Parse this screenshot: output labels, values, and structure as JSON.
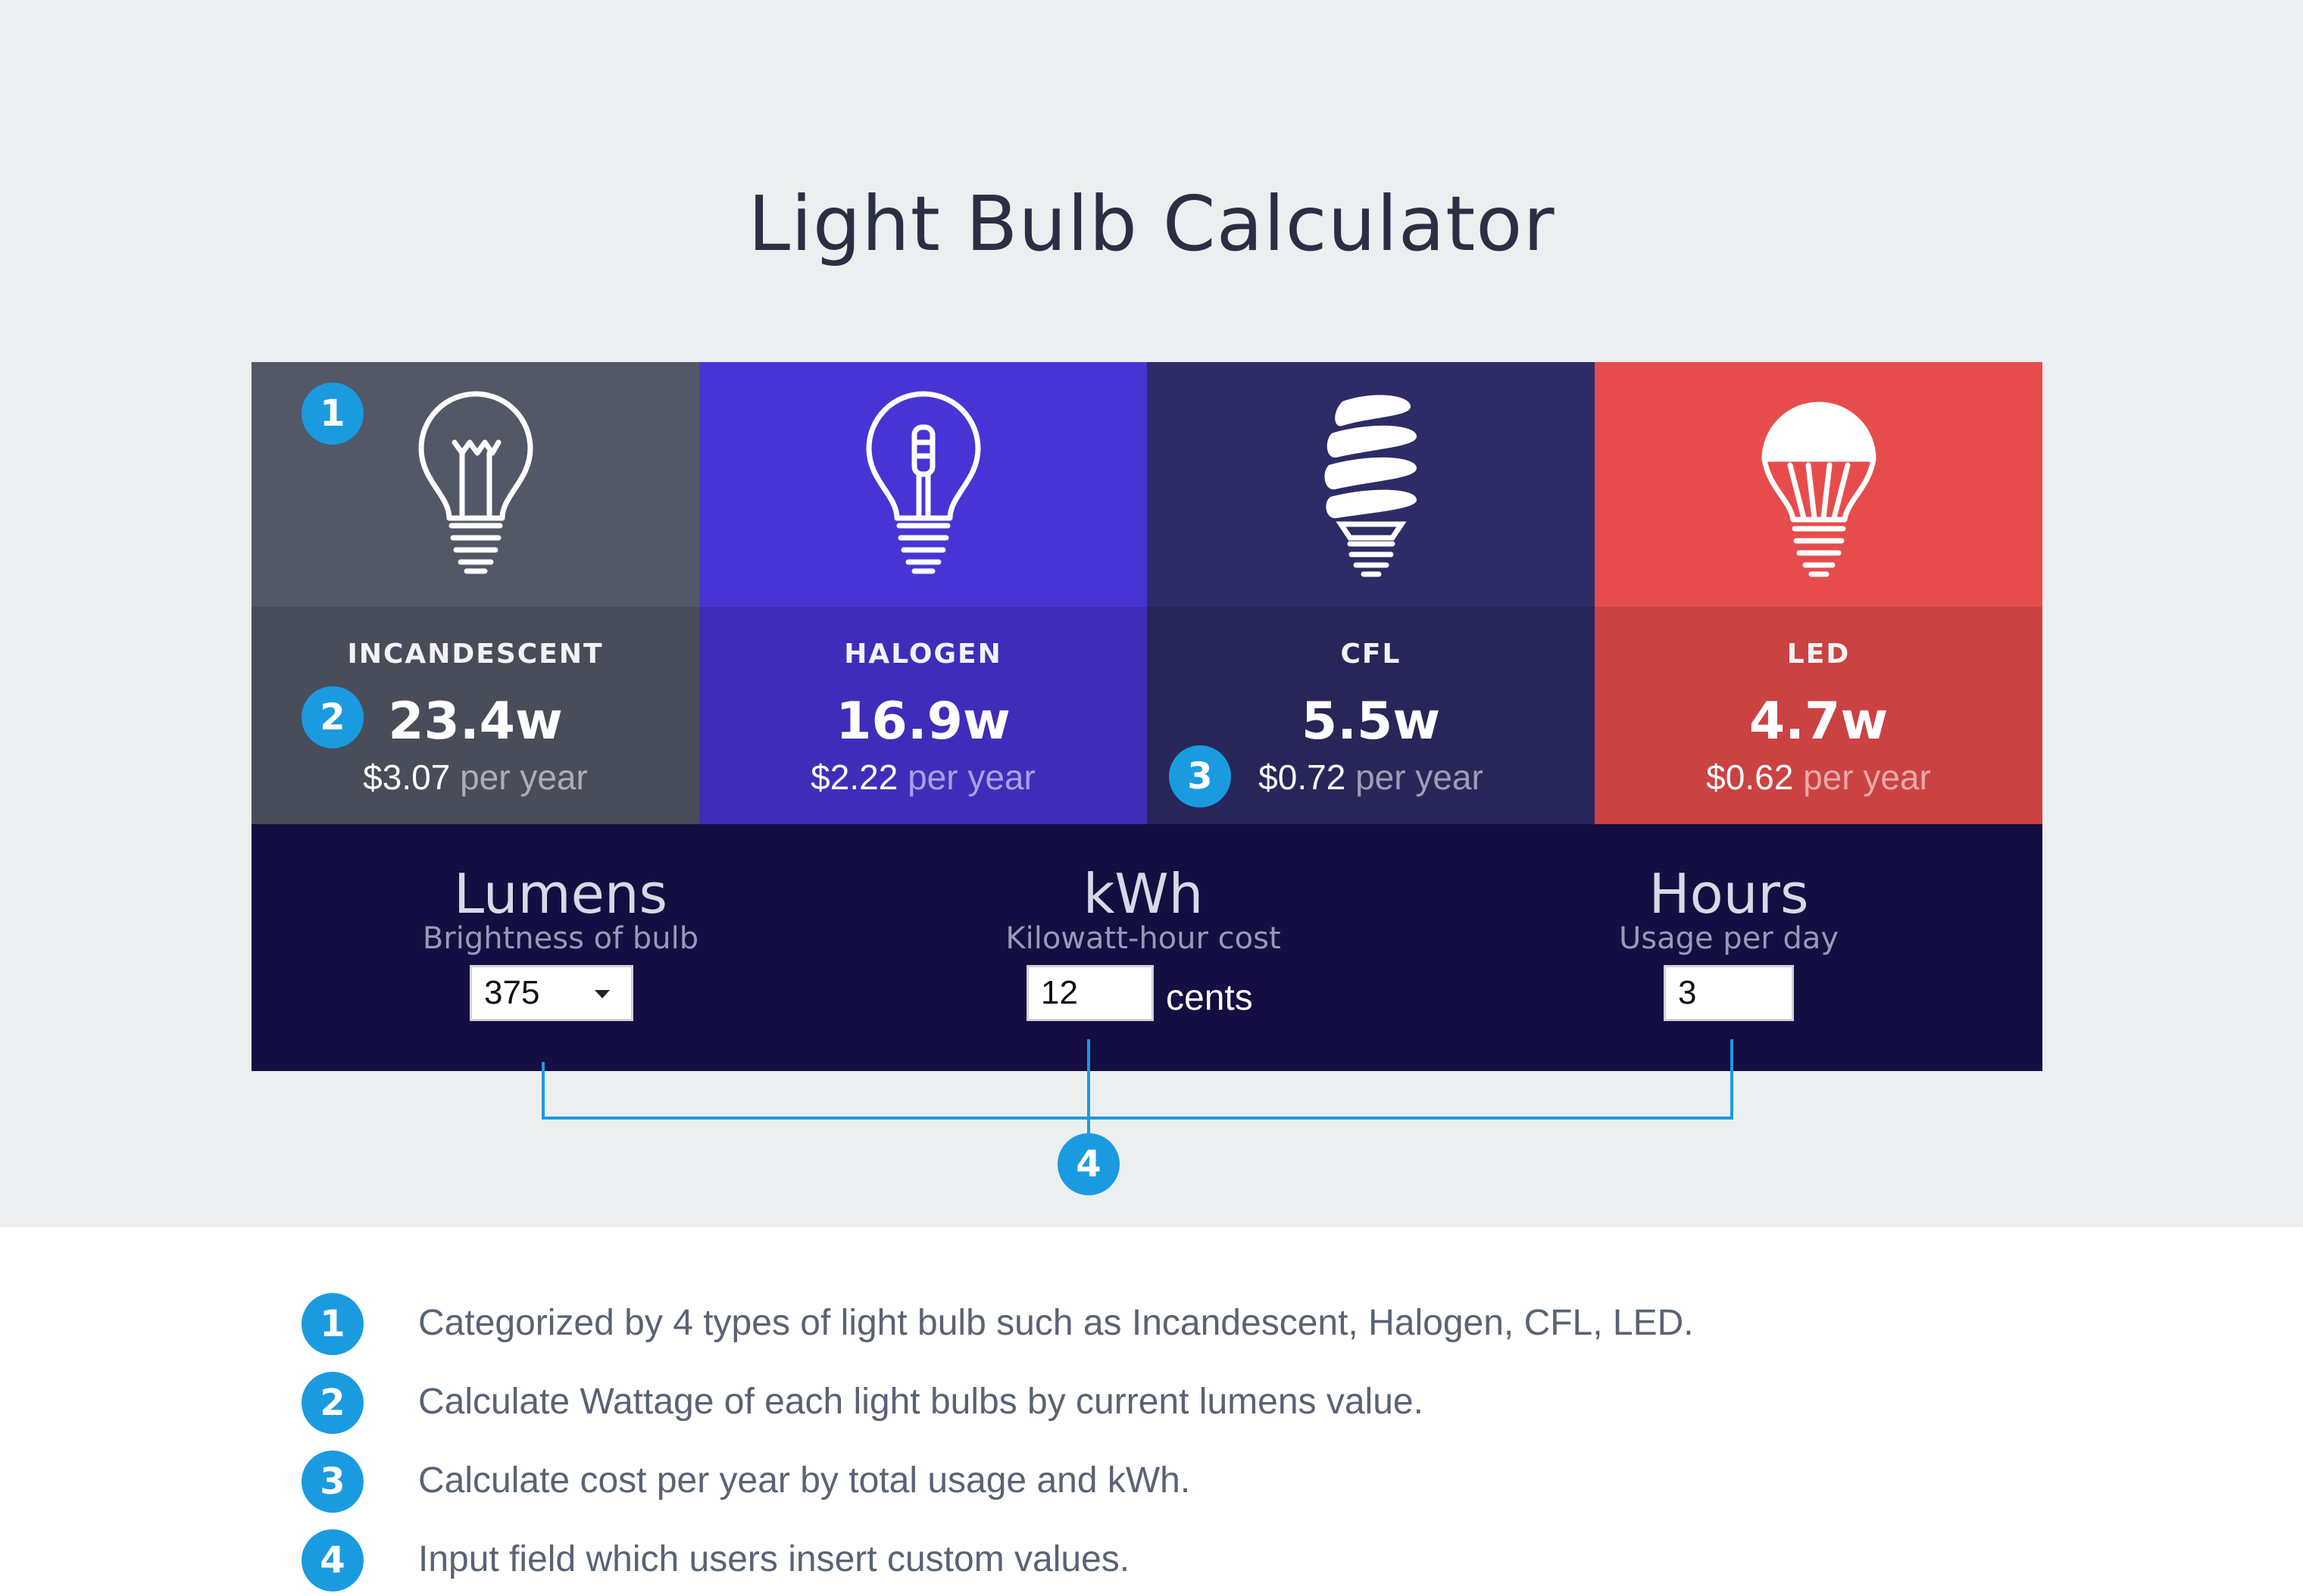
{
  "page": {
    "title": "Light Bulb Calculator",
    "background_color": "#eceff0"
  },
  "bulbs": [
    {
      "name": "INCANDESCENT",
      "watt": "23.4w",
      "cost": "$3.07",
      "per": "per year",
      "color": "#525866",
      "icon": "incandescent-bulb-icon"
    },
    {
      "name": "HALOGEN",
      "watt": "16.9w",
      "cost": "$2.22",
      "per": "per year",
      "color": "#4834d4",
      "icon": "halogen-bulb-icon"
    },
    {
      "name": "CFL",
      "watt": "5.5w",
      "cost": "$0.72",
      "per": "per year",
      "color": "#2e2c66",
      "icon": "cfl-bulb-icon"
    },
    {
      "name": "LED",
      "watt": "4.7w",
      "cost": "$0.62",
      "per": "per year",
      "color": "#e74c4c",
      "icon": "led-bulb-icon"
    }
  ],
  "controls": {
    "lumens": {
      "title": "Lumens",
      "subtitle": "Brightness of bulb",
      "value": "375"
    },
    "kwh": {
      "title": "kWh",
      "subtitle": "Kilowatt-hour cost",
      "value": "12",
      "unit": "cents"
    },
    "hours": {
      "title": "Hours",
      "subtitle": "Usage per day",
      "value": "3"
    }
  },
  "annotations": {
    "badge_color": "#1a9be0",
    "markers": [
      "1",
      "2",
      "3",
      "4"
    ],
    "legend": [
      {
        "num": "1",
        "text": "Categorized by 4 types of light bulb such as Incandescent, Halogen, CFL, LED."
      },
      {
        "num": "2",
        "text": "Calculate Wattage of each light bulbs by current lumens value."
      },
      {
        "num": "3",
        "text": "Calculate cost per year by total usage and kWh."
      },
      {
        "num": "4",
        "text": "Input field which users insert custom values."
      }
    ]
  }
}
